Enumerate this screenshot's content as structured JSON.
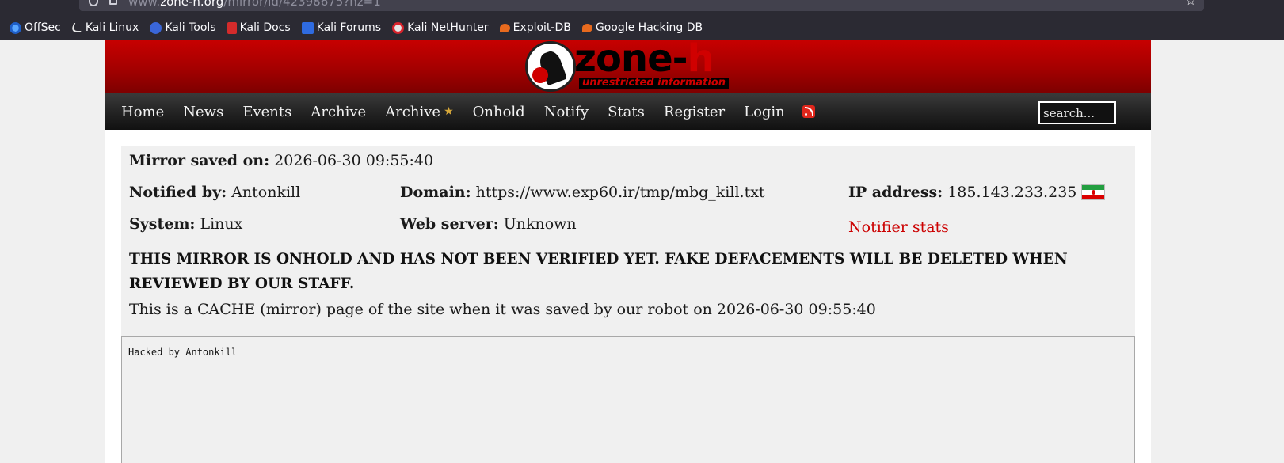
{
  "browser": {
    "url_prefix": "www.",
    "url_host": "zone-h.org",
    "url_path": "/mirror/id/42398675?hz=1",
    "bookmarks": [
      {
        "label": "OffSec",
        "icon": "offsec-icon"
      },
      {
        "label": "Kali Linux",
        "icon": "kali-dragon-icon"
      },
      {
        "label": "Kali Tools",
        "icon": "kali-tools-icon"
      },
      {
        "label": "Kali Docs",
        "icon": "kali-docs-icon"
      },
      {
        "label": "Kali Forums",
        "icon": "kali-forums-icon"
      },
      {
        "label": "Kali NetHunter",
        "icon": "nethunter-icon"
      },
      {
        "label": "Exploit-DB",
        "icon": "exploit-db-icon"
      },
      {
        "label": "Google Hacking DB",
        "icon": "ghdb-icon"
      }
    ]
  },
  "header": {
    "logo_word": "zone-",
    "logo_word_h": "h",
    "logo_tagline": "unrestricted information"
  },
  "nav": {
    "items": [
      "Home",
      "News",
      "Events",
      "Archive",
      "Archive",
      "Onhold",
      "Notify",
      "Stats",
      "Register",
      "Login"
    ],
    "search_placeholder": "search..."
  },
  "mirror": {
    "saved_label": "Mirror saved on:",
    "saved_value": "2026-06-30 09:55:40",
    "notified_label": "Notified by:",
    "notified_value": "Antonkill",
    "domain_label": "Domain:",
    "domain_value": "https://www.exp60.ir/tmp/mbg_kill.txt",
    "ip_label": "IP address:",
    "ip_value": "185.143.233.235",
    "system_label": "System:",
    "system_value": "Linux",
    "webserver_label": "Web server:",
    "webserver_value": "Unknown",
    "notifier_stats": "Notifier stats",
    "warning": "THIS MIRROR IS ONHOLD AND HAS NOT BEEN VERIFIED YET. FAKE DEFACEMENTS WILL BE DELETED WHEN REVIEWED BY OUR STAFF.",
    "cache_note": "This is a CACHE (mirror) page of the site when it was saved by our robot on 2026-06-30 09:55:40",
    "content_text": "Hacked by Antonkill"
  },
  "colors": {
    "banner_red": "#c80000",
    "nav_dark": "#222222",
    "link_red": "#cc0000",
    "content_bg": "#f0f0f0"
  }
}
